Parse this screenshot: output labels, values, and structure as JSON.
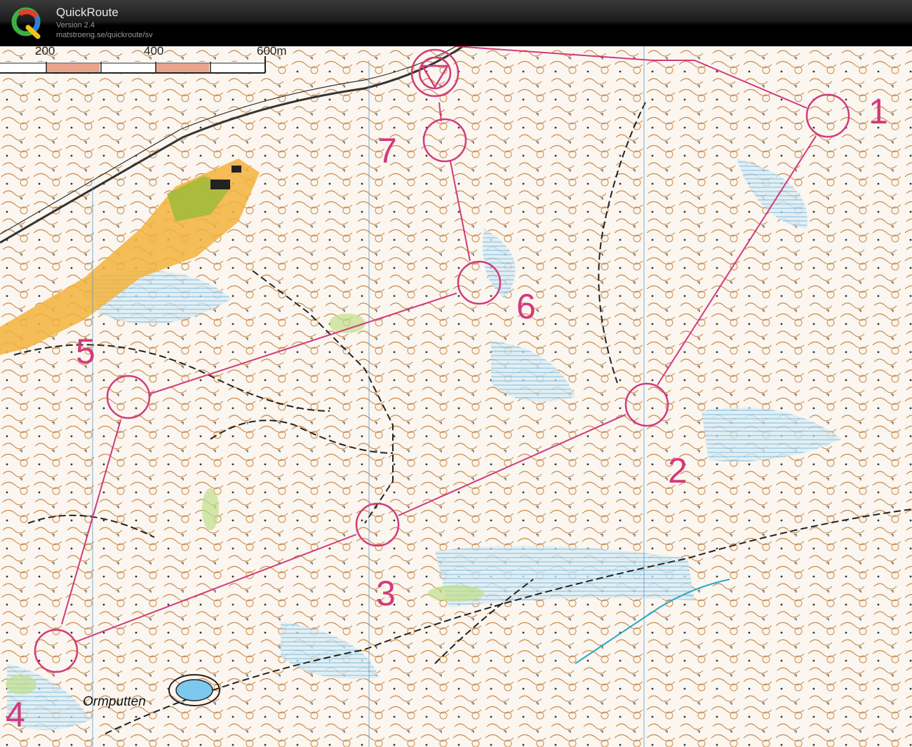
{
  "app": {
    "name": "QuickRoute",
    "version": "Version 2.4",
    "url": "matstroeng.se/quickroute/sv"
  },
  "map": {
    "scale_labels": [
      "200",
      "400",
      "600m"
    ],
    "control_labels": [
      "1",
      "2",
      "3",
      "4",
      "5",
      "6",
      "7"
    ],
    "feature_label": "Ormputten",
    "course_color": "#d23a7c"
  }
}
